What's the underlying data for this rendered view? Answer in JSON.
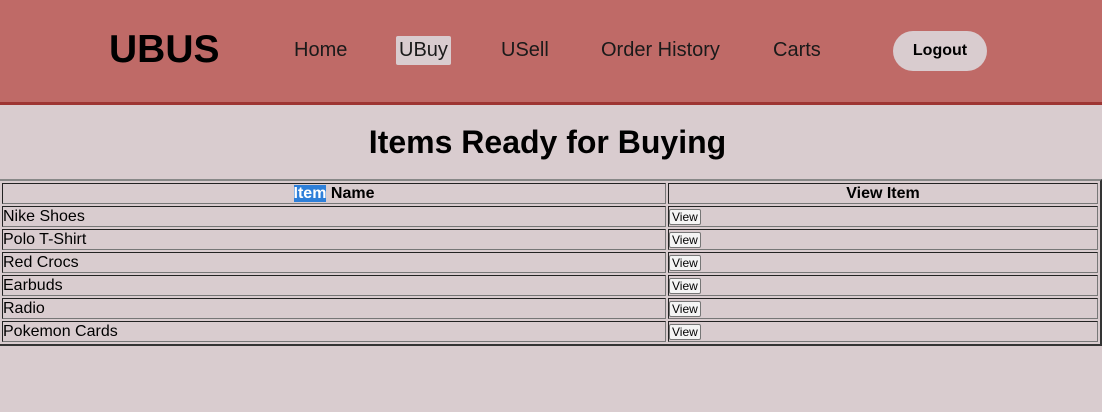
{
  "header": {
    "logo": "UBUS",
    "nav": [
      {
        "label": "Home",
        "active": false
      },
      {
        "label": "UBuy",
        "active": true
      },
      {
        "label": "USell",
        "active": false
      },
      {
        "label": "Order History",
        "active": false
      },
      {
        "label": "Carts",
        "active": false
      }
    ],
    "logout_label": "Logout"
  },
  "main": {
    "title": "Items Ready for Buying",
    "table": {
      "headers": {
        "name_selected": "Item",
        "name_rest": " Name",
        "view": "View Item"
      },
      "rows": [
        {
          "name": "Nike Shoes",
          "button": "View"
        },
        {
          "name": "Polo T-Shirt",
          "button": "View"
        },
        {
          "name": "Red Crocs",
          "button": "View"
        },
        {
          "name": "Earbuds",
          "button": "View"
        },
        {
          "name": "Radio",
          "button": "View"
        },
        {
          "name": "Pokemon Cards",
          "button": "View"
        }
      ]
    }
  },
  "colors": {
    "header_bg": "#bf6a67",
    "header_border": "#9e3533",
    "page_bg": "#d9cccf",
    "selection": "#2e7fd9"
  }
}
